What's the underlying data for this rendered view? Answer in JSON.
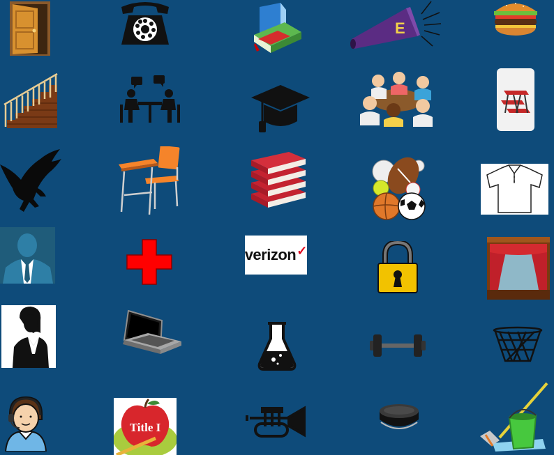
{
  "colors": {
    "background": "#0E4B7A",
    "verizon_red": "#E0001B",
    "cross_red": "#FF0000",
    "megaphone_purple": "#5B2C83",
    "bucket_green": "#47C83E"
  },
  "tiles": [
    {
      "icon": "door-icon"
    },
    {
      "icon": "rotary-phone-icon"
    },
    {
      "icon": "books-icon"
    },
    {
      "icon": "megaphone-icon",
      "letter": "E"
    },
    {
      "icon": "hamburger-icon"
    },
    {
      "icon": "staircase-icon"
    },
    {
      "icon": "counseling-meeting-icon"
    },
    {
      "icon": "graduation-cap-icon"
    },
    {
      "icon": "student-group-icon"
    },
    {
      "icon": "picnic-table-icon"
    },
    {
      "icon": "eagle-icon"
    },
    {
      "icon": "school-desk-icon"
    },
    {
      "icon": "red-books-stack-icon"
    },
    {
      "icon": "sports-balls-icon"
    },
    {
      "icon": "polo-shirt-icon"
    },
    {
      "icon": "businessman-icon"
    },
    {
      "icon": "red-cross-icon"
    },
    {
      "icon": "verizon-logo",
      "word": "verizon",
      "mark": "✓"
    },
    {
      "icon": "padlock-icon"
    },
    {
      "icon": "theater-stage-icon"
    },
    {
      "icon": "businesswoman-icon"
    },
    {
      "icon": "laptop-icon"
    },
    {
      "icon": "flask-icon"
    },
    {
      "icon": "dumbbell-icon"
    },
    {
      "icon": "basketball-hoop-icon"
    },
    {
      "icon": "receptionist-icon"
    },
    {
      "icon": "title-one-apple-icon",
      "label": "Title I"
    },
    {
      "icon": "trumpet-icon"
    },
    {
      "icon": "hockey-puck-icon"
    },
    {
      "icon": "mop-bucket-icon"
    }
  ]
}
